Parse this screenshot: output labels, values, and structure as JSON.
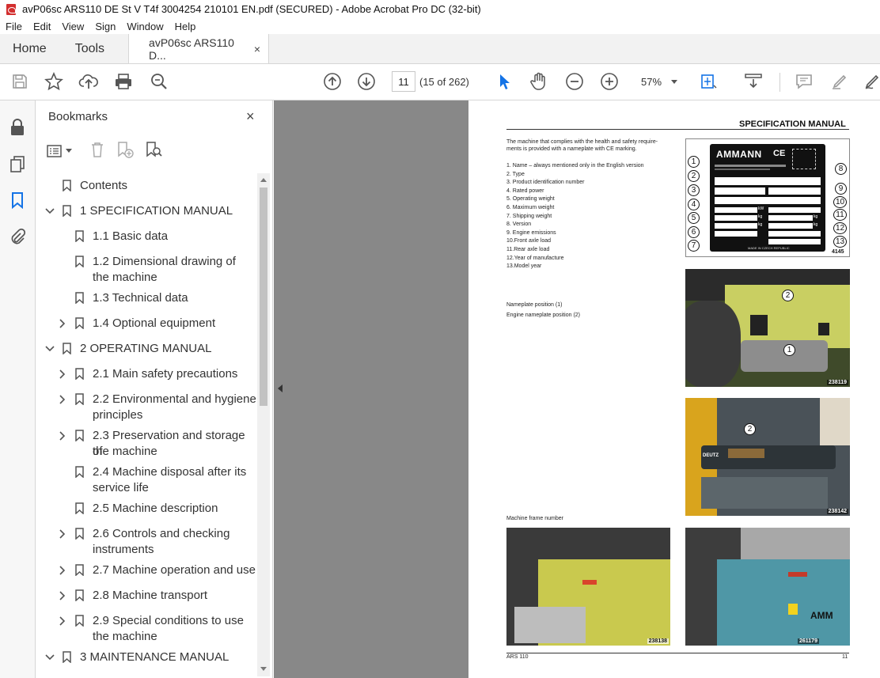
{
  "window": {
    "title": "avP06sc ARS110 DE St V T4f 3004254 210101 EN.pdf (SECURED) - Adobe Acrobat Pro DC (32-bit)"
  },
  "menu": [
    "File",
    "Edit",
    "View",
    "Sign",
    "Window",
    "Help"
  ],
  "tabs": {
    "home": "Home",
    "tools": "Tools",
    "doc": "avP06sc ARS110 D...",
    "close": "×"
  },
  "toolbar": {
    "page_current": "11",
    "page_count": "(15 of 262)",
    "zoom": "57%"
  },
  "bookmarks": {
    "title": "Bookmarks",
    "close": "×",
    "items": [
      {
        "label": "Contents",
        "level": 0,
        "expandable": false,
        "expanded": false
      },
      {
        "label": "1 SPECIFICATION MANUAL",
        "level": 0,
        "expandable": true,
        "expanded": true
      },
      {
        "label": "1.1 Basic data",
        "level": 1,
        "expandable": false
      },
      {
        "label": "1.2 Dimensional drawing of",
        "label2": "the machine",
        "level": 1,
        "expandable": false
      },
      {
        "label": "1.3 Technical data",
        "level": 1,
        "expandable": false
      },
      {
        "label": "1.4 Optional equipment",
        "level": 1,
        "expandable": true,
        "expanded": false
      },
      {
        "label": "2 OPERATING MANUAL",
        "level": 0,
        "expandable": true,
        "expanded": true
      },
      {
        "label": "2.1 Main safety precautions",
        "level": 1,
        "expandable": true,
        "expanded": false
      },
      {
        "label": "2.2 Environmental and hygiene",
        "label2": "principles",
        "level": 1,
        "expandable": true,
        "expanded": false
      },
      {
        "label": "2.3 Preservation and storage of",
        "label2": "the machine",
        "level": 1,
        "expandable": true,
        "expanded": false
      },
      {
        "label": "2.4 Machine disposal after its",
        "label2": "service life",
        "level": 1,
        "expandable": false
      },
      {
        "label": "2.5 Machine description",
        "level": 1,
        "expandable": false
      },
      {
        "label": "2.6 Controls and checking",
        "label2": "instruments",
        "level": 1,
        "expandable": true,
        "expanded": false
      },
      {
        "label": "2.7 Machine operation and use",
        "level": 1,
        "expandable": true,
        "expanded": false
      },
      {
        "label": "2.8 Machine transport",
        "level": 1,
        "expandable": true,
        "expanded": false
      },
      {
        "label": "2.9 Special conditions to use",
        "label2": "the machine",
        "level": 1,
        "expandable": true,
        "expanded": false
      },
      {
        "label": "3 MAINTENANCE MANUAL",
        "level": 0,
        "expandable": true,
        "expanded": true
      }
    ]
  },
  "pdf": {
    "header": "SPECIFICATION MANUAL",
    "intro1": "The machine that complies with the health and safety require-",
    "intro2": "ments is provided with a nameplate with CE marking.",
    "list": [
      "1. Name – always mentioned only in the English version",
      "2. Type",
      "3. Product identification number",
      "4. Rated power",
      "5. Operating weight",
      "6. Maximum weight",
      "7. Shipping weight",
      "8. Version",
      "9. Engine emissions",
      "10.Front axle load",
      "11.Rear axle load",
      "12.Year of manufacture",
      "13.Model year"
    ],
    "nameplate_brand": "AMMANN",
    "nameplate_ce": "CE",
    "nameplate_callouts_left": [
      "1",
      "2",
      "3",
      "4",
      "5",
      "6",
      "7"
    ],
    "nameplate_callouts_right": [
      "8",
      "9",
      "10",
      "11",
      "12",
      "13"
    ],
    "nameplate_units": [
      "kW",
      "kg",
      "kg",
      "kg",
      "kg"
    ],
    "nameplate_made_in": "MADE IN CZECH REPUBLIC",
    "fig1_no": "4145",
    "nameplate_pos1": "Nameplate position (1)",
    "nameplate_pos2": "Engine nameplate position (2)",
    "fig2_no": "238119",
    "fig2_callouts": [
      "2",
      "1"
    ],
    "fig3_no": "238142",
    "fig3_callouts": [
      "2"
    ],
    "fig3_engine_brand": "DEUTZ",
    "frame_number": "Machine frame number",
    "fig4_no": "238138",
    "fig5_no": "261179",
    "fig5_brand": "AMM",
    "footer_left": "ARS 110",
    "footer_right": "11"
  }
}
